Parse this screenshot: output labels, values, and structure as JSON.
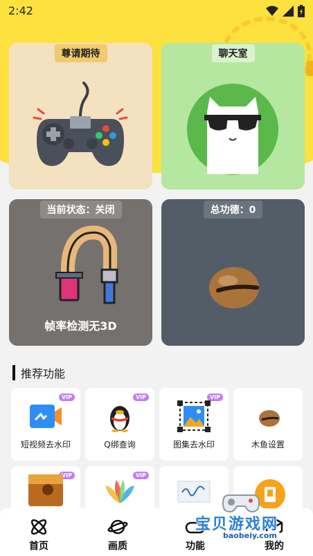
{
  "status_bar": {
    "time": "2:42"
  },
  "cards": [
    {
      "label": "尊请期待"
    },
    {
      "label": "聊天室"
    },
    {
      "label": "当前状态：关闭",
      "caption": "帧率检测无3D"
    },
    {
      "label": "总功德：0"
    }
  ],
  "section": {
    "title": "推荐功能"
  },
  "tiles": [
    {
      "label": "短视频去水印",
      "badge": "VIP",
      "icon": "video-camera-icon"
    },
    {
      "label": "Q绑查询",
      "badge": "VIP",
      "icon": "penguin-icon"
    },
    {
      "label": "图集去水印",
      "badge": "VIP",
      "icon": "image-crop-icon"
    },
    {
      "label": "木鱼设置",
      "badge": "",
      "icon": "wooden-fish-icon"
    },
    {
      "label": "",
      "badge": "VIP",
      "icon": "game-art-icon"
    },
    {
      "label": "",
      "badge": "VIP",
      "icon": "petal-flower-icon"
    },
    {
      "label": "",
      "badge": "",
      "icon": "signature-design-icon"
    },
    {
      "label": "",
      "badge": "",
      "icon": "floating-action-icon"
    }
  ],
  "bottom_nav": [
    {
      "label": "首页",
      "icon": "atom-icon"
    },
    {
      "label": "画质",
      "icon": "planet-icon"
    },
    {
      "label": "功能",
      "icon": "controller-icon"
    },
    {
      "label": "我的",
      "icon": "cube-icon"
    }
  ],
  "watermark": {
    "text": "宝贝游戏网",
    "url": "baobeiy.com"
  },
  "colors": {
    "accent_yellow": "#fde13f",
    "vip_purple": "#c07ef0",
    "watermark_blue": "#2a7fd6"
  }
}
